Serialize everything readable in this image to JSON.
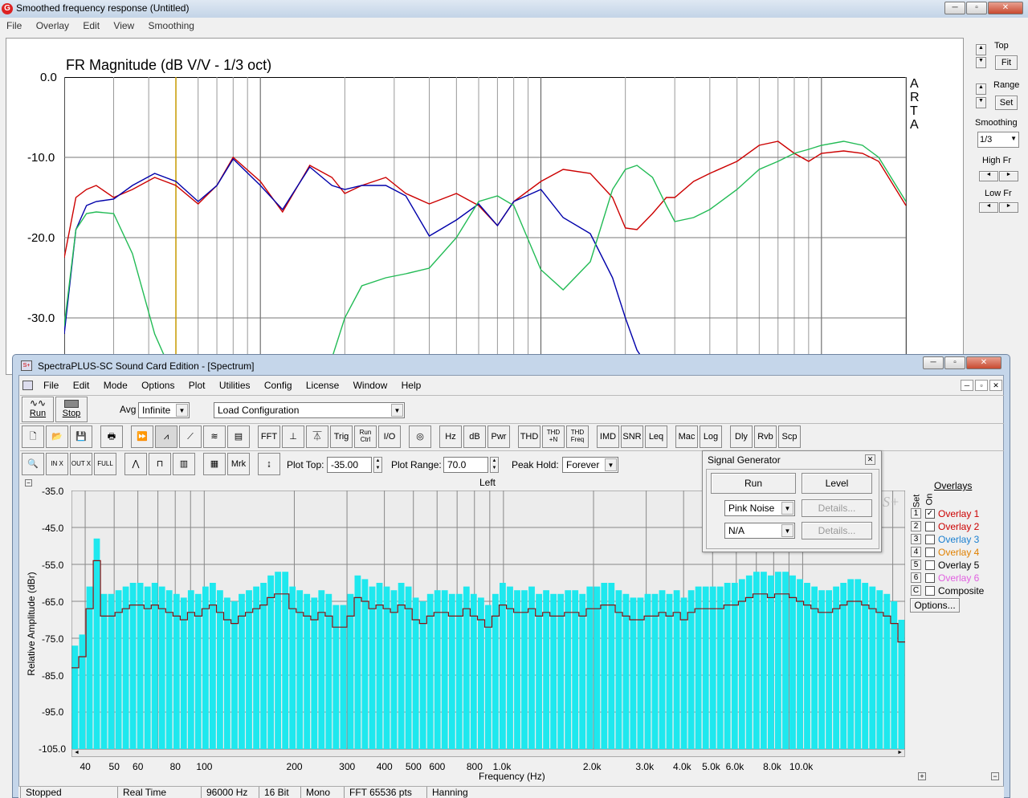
{
  "window": {
    "title": "Smoothed frequency response (Untitled)"
  },
  "menu": [
    "File",
    "Overlay",
    "Edit",
    "View",
    "Smoothing"
  ],
  "plot": {
    "title": "FR Magnitude (dB V/V - 1/3 oct)",
    "watermark": [
      "A",
      "R",
      "T",
      "A"
    ],
    "yticks": [
      "0.0",
      "-10.0",
      "-20.0",
      "-30.0"
    ]
  },
  "side": {
    "top_label": "Top",
    "fit": "Fit",
    "range_label": "Range",
    "set": "Set",
    "smoothing_label": "Smoothing",
    "smoothing_value": "1/3",
    "high_label": "High Fr",
    "low_label": "Low Fr"
  },
  "chart_data": {
    "type": "line",
    "title": "FR Magnitude (dB V/V - 1/3 oct)",
    "ylim": [
      -35,
      0
    ],
    "yscale": "linear",
    "xscale": "log",
    "xlim": [
      20,
      20000
    ],
    "series": [
      {
        "color": "#cc0000",
        "x": [
          20,
          22,
          24,
          26,
          30,
          35,
          42,
          50,
          60,
          70,
          80,
          100,
          120,
          150,
          180,
          200,
          230,
          280,
          330,
          400,
          500,
          600,
          700,
          800,
          1000,
          1200,
          1500,
          1800,
          2000,
          2200,
          2500,
          2800,
          3000,
          3500,
          4000,
          5000,
          6000,
          7000,
          8000,
          9000,
          10000,
          12000,
          14000,
          16000,
          20000
        ],
        "y": [
          -22.5,
          -15,
          -14,
          -13.5,
          -15,
          -14,
          -12.5,
          -13.5,
          -15.8,
          -13.5,
          -10,
          -13,
          -16.8,
          -11,
          -12.5,
          -14.5,
          -13.5,
          -12.5,
          -14.5,
          -15.8,
          -14.5,
          -16,
          -18.5,
          -15.5,
          -13,
          -11.5,
          -12,
          -15,
          -18.8,
          -19,
          -17,
          -15,
          -15,
          -13,
          -12,
          -10.5,
          -8.5,
          -8,
          -9.5,
          -10.5,
          -9.5,
          -9.2,
          -9.5,
          -10.5,
          -16
        ]
      },
      {
        "color": "#0000aa",
        "x": [
          20,
          22,
          24,
          26,
          30,
          35,
          42,
          50,
          60,
          70,
          80,
          100,
          120,
          150,
          180,
          200,
          230,
          280,
          330,
          400,
          500,
          600,
          700,
          800,
          1000,
          1200,
          1500,
          1800,
          2000,
          2200,
          2500,
          2800,
          3000
        ],
        "y": [
          -32,
          -19,
          -16,
          -15.5,
          -15.2,
          -13.5,
          -12,
          -13,
          -15.5,
          -13.5,
          -10.2,
          -13.5,
          -16.5,
          -11.2,
          -13.5,
          -14,
          -13.5,
          -13.5,
          -14.8,
          -19.8,
          -17.8,
          -15.8,
          -18.5,
          -15.5,
          -14,
          -17.5,
          -19.5,
          -25,
          -30,
          -34,
          -37,
          -40,
          -42
        ]
      },
      {
        "color": "#22bb55",
        "x": [
          20,
          22,
          24,
          26,
          30,
          35,
          42,
          50,
          60,
          70,
          80,
          100,
          120,
          150,
          180,
          200,
          230,
          280,
          330,
          400,
          500,
          600,
          700,
          800,
          1000,
          1200,
          1500,
          1800,
          2000,
          2200,
          2500,
          2800,
          3000,
          3500,
          4000,
          5000,
          6000,
          7000,
          8000,
          9000,
          10000,
          12000,
          14000,
          16000,
          20000
        ],
        "y": [
          -31,
          -19,
          -17,
          -16.8,
          -17,
          -22,
          -32,
          -38,
          -40,
          -40,
          -40,
          -40,
          -40,
          -38,
          -35,
          -30,
          -26,
          -25,
          -24.5,
          -23.8,
          -20,
          -15.5,
          -14.8,
          -16,
          -24,
          -26.5,
          -23,
          -14,
          -11.5,
          -11,
          -12.5,
          -16,
          -18,
          -17.5,
          -16.5,
          -14,
          -11.5,
          -10.5,
          -9.5,
          -9,
          -8.5,
          -8,
          -8.5,
          -10,
          -15.5
        ]
      }
    ]
  },
  "spectra": {
    "title": "SpectraPLUS-SC Sound Card Edition - [Spectrum]",
    "menu": [
      "File",
      "Edit",
      "Mode",
      "Options",
      "Plot",
      "Utilities",
      "Config",
      "License",
      "Window",
      "Help"
    ],
    "run": "Run",
    "stop": "Stop",
    "avg_label": "Avg",
    "avg_value": "Infinite",
    "load_config": "Load Configuration",
    "toolbar2": [
      "FFT",
      "Trig",
      "Run\nCtrl",
      "I/O",
      "Hz",
      "dB",
      "Pwr",
      "THD",
      "THD\n+N",
      "THD\nFreq",
      "IMD",
      "SNR",
      "Leq",
      "Mac",
      "Log",
      "Dly",
      "Rvb",
      "Scp"
    ],
    "plot_top_label": "Plot Top:",
    "plot_top_value": "-35.00",
    "plot_range_label": "Plot Range:",
    "plot_range_value": "70.0",
    "peak_hold_label": "Peak Hold:",
    "peak_hold_value": "Forever",
    "mrk": "Mrk",
    "channel": "Left",
    "ylabel": "Relative Amplitude (dBr)",
    "xlabel": "Frequency (Hz)",
    "yticks": [
      "-35.0",
      "-45.0",
      "-55.0",
      "-65.0",
      "-75.0",
      "-85.0",
      "-95.0",
      "-105.0"
    ],
    "xticks": [
      "40",
      "50",
      "60",
      "80",
      "100",
      "200",
      "300",
      "400",
      "500",
      "600",
      "800",
      "1.0k",
      "2.0k",
      "3.0k",
      "4.0k",
      "5.0k",
      "6.0k",
      "8.0k",
      "10.0k"
    ]
  },
  "sig_gen": {
    "title": "Signal Generator",
    "run": "Run",
    "level": "Level",
    "signal": "Pink Noise",
    "second": "N/A",
    "details": "Details..."
  },
  "overlays": {
    "header": "Overlays",
    "set": "Set",
    "on": "On",
    "options": "Options...",
    "items": [
      {
        "n": "1",
        "name": "Overlay 1",
        "color": "#cc0000",
        "checked": true
      },
      {
        "n": "2",
        "name": "Overlay 2",
        "color": "#cc0000",
        "checked": false
      },
      {
        "n": "3",
        "name": "Overlay 3",
        "color": "#1a7fd0",
        "checked": false
      },
      {
        "n": "4",
        "name": "Overlay 4",
        "color": "#e08000",
        "checked": false
      },
      {
        "n": "5",
        "name": "Overlay 5",
        "color": "#000000",
        "checked": false
      },
      {
        "n": "6",
        "name": "Overlay 6",
        "color": "#e060e0",
        "checked": false
      },
      {
        "n": "C",
        "name": "Composite",
        "color": "#000000",
        "checked": false
      }
    ]
  },
  "status": [
    "Stopped",
    "Real Time",
    "96000 Hz",
    "16 Bit",
    "Mono",
    "FFT 65536 pts",
    "Hanning"
  ],
  "spectrum_data": {
    "type": "bar",
    "bars": [
      -77,
      -74,
      -61,
      -48,
      -63,
      -63,
      -62,
      -61,
      -60,
      -60,
      -61,
      -60,
      -61,
      -62,
      -63,
      -64,
      -62,
      -63,
      -61,
      -60,
      -62,
      -64,
      -65,
      -63,
      -62,
      -61,
      -60,
      -58,
      -57,
      -57,
      -61,
      -62,
      -63,
      -64,
      -62,
      -63,
      -66,
      -66,
      -63,
      -58,
      -59,
      -61,
      -60,
      -61,
      -62,
      -60,
      -61,
      -64,
      -65,
      -63,
      -62,
      -62,
      -63,
      -63,
      -61,
      -63,
      -64,
      -66,
      -63,
      -60,
      -61,
      -62,
      -62,
      -61,
      -63,
      -62,
      -63,
      -63,
      -62,
      -62,
      -63,
      -61,
      -61,
      -60,
      -60,
      -62,
      -63,
      -64,
      -64,
      -63,
      -63,
      -62,
      -63,
      -62,
      -64,
      -62,
      -61,
      -61,
      -61,
      -61,
      -60,
      -60,
      -59,
      -58,
      -57,
      -57,
      -58,
      -57,
      -57,
      -58,
      -59,
      -60,
      -61,
      -62,
      -62,
      -61,
      -60,
      -59,
      -59,
      -60,
      -61,
      -62,
      -63,
      -65,
      -70
    ]
  }
}
